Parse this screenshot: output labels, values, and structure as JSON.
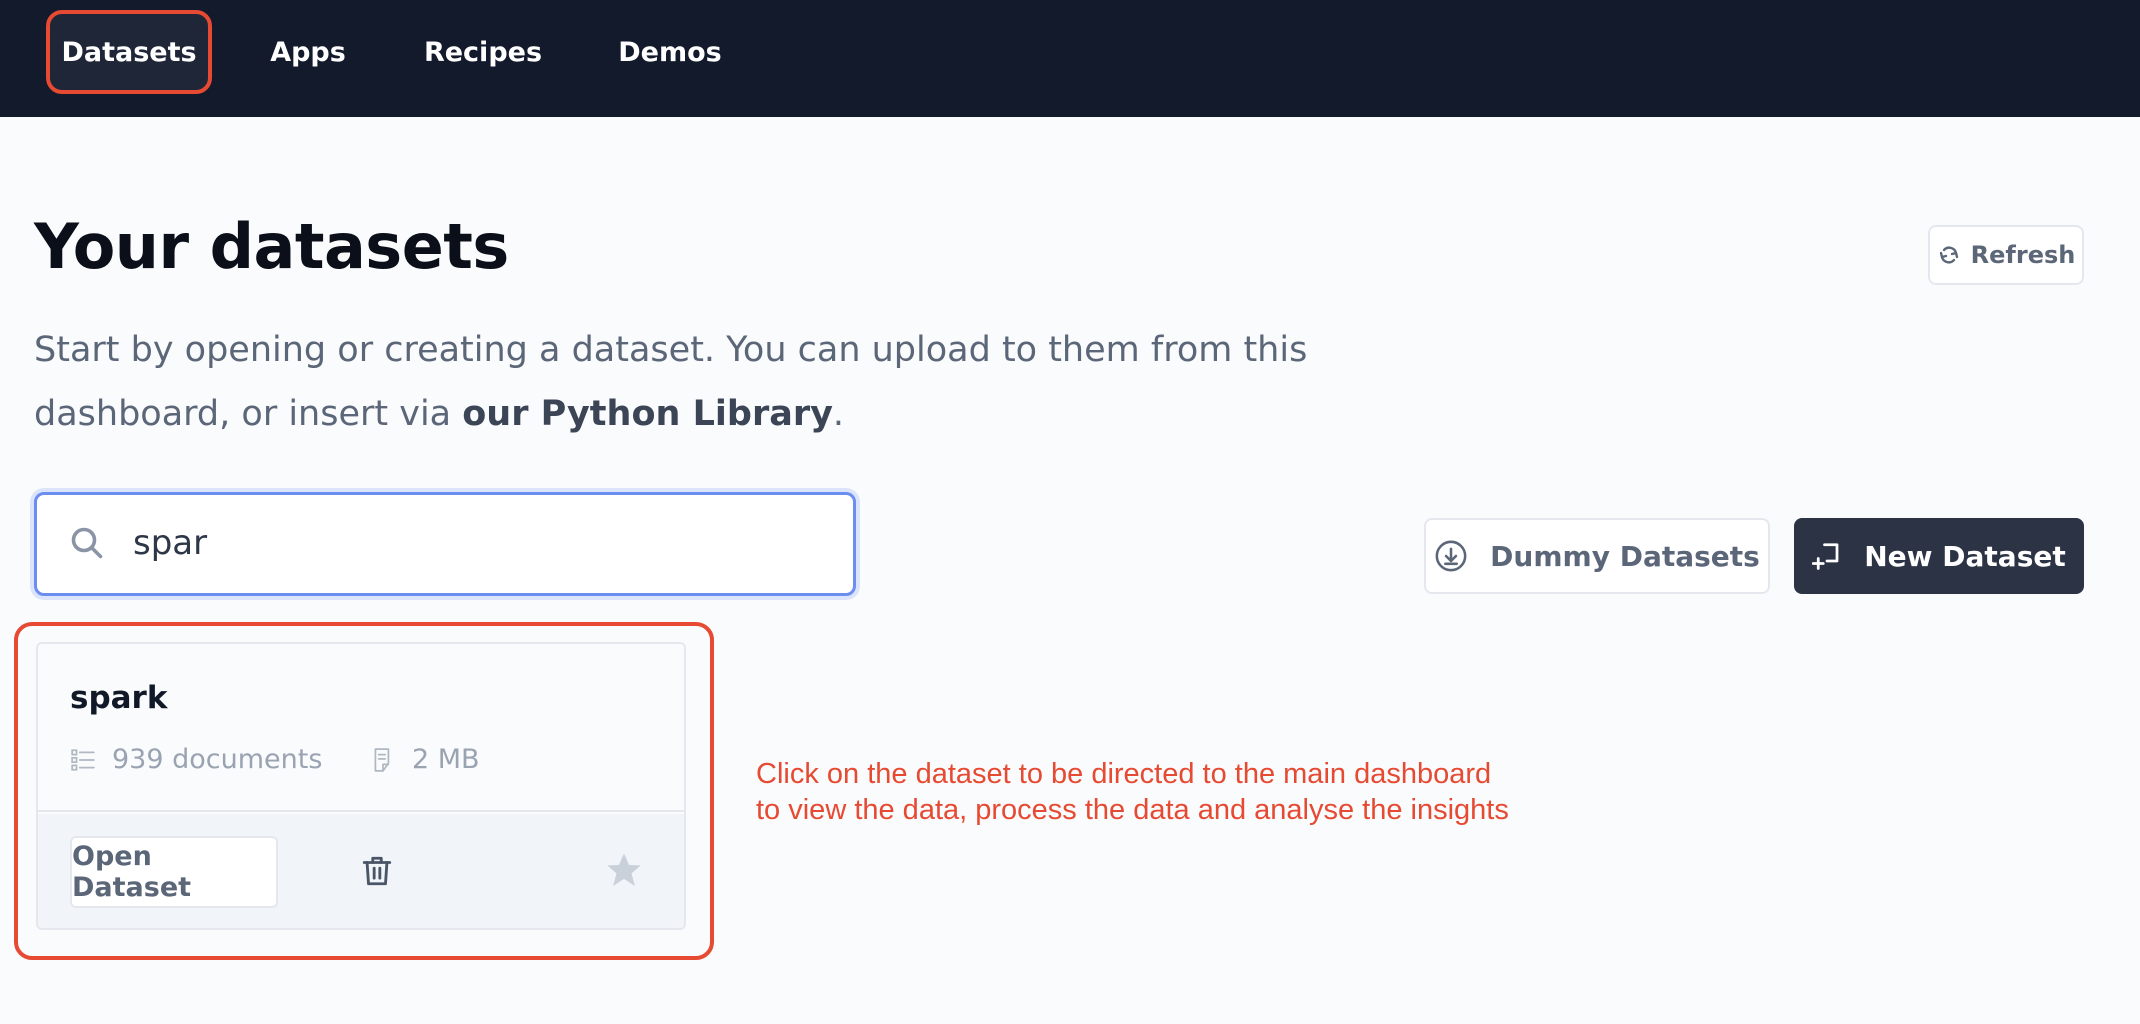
{
  "nav": {
    "items": [
      {
        "label": "Datasets",
        "active": true
      },
      {
        "label": "Apps"
      },
      {
        "label": "Recipes"
      },
      {
        "label": "Demos"
      }
    ]
  },
  "header": {
    "title": "Your datasets",
    "subtitle_prefix": "Start by opening or creating a dataset. You can upload to them from this dashboard, or insert via ",
    "subtitle_link": "our Python Library",
    "subtitle_suffix": ".",
    "refresh_label": "Refresh"
  },
  "search": {
    "value": "spar",
    "icon": "search-icon"
  },
  "actions": {
    "dummy_label": "Dummy Datasets",
    "new_label": "New Dataset"
  },
  "datasets": [
    {
      "name": "spark",
      "documents": "939 documents",
      "size": "2 MB",
      "open_label": "Open Dataset"
    }
  ],
  "annotation": {
    "text": "Click on the dataset to be directed to the main dashboard\nto view the data, process the data and analyse the insights"
  },
  "colors": {
    "topbar": "#131a2c",
    "highlight": "#e64a32",
    "primary_button": "#2b3345",
    "focus": "#6b8ef0"
  }
}
